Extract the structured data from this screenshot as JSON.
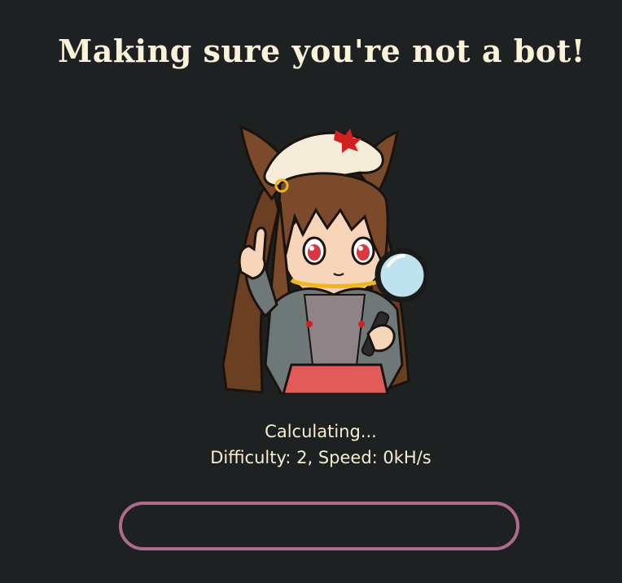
{
  "page": {
    "title": "Making sure you're not a bot!"
  },
  "status": {
    "message": "Calculating...",
    "details": "Difficulty: 2, Speed: 0kH/s"
  },
  "progress": {
    "fraction": 0.0
  },
  "mascot": {
    "icon": "anime-girl-magnifying-glass-mascot"
  },
  "colors": {
    "background": "#1e2122",
    "text": "#fbf2da",
    "progress_border": "#b06a8d"
  }
}
